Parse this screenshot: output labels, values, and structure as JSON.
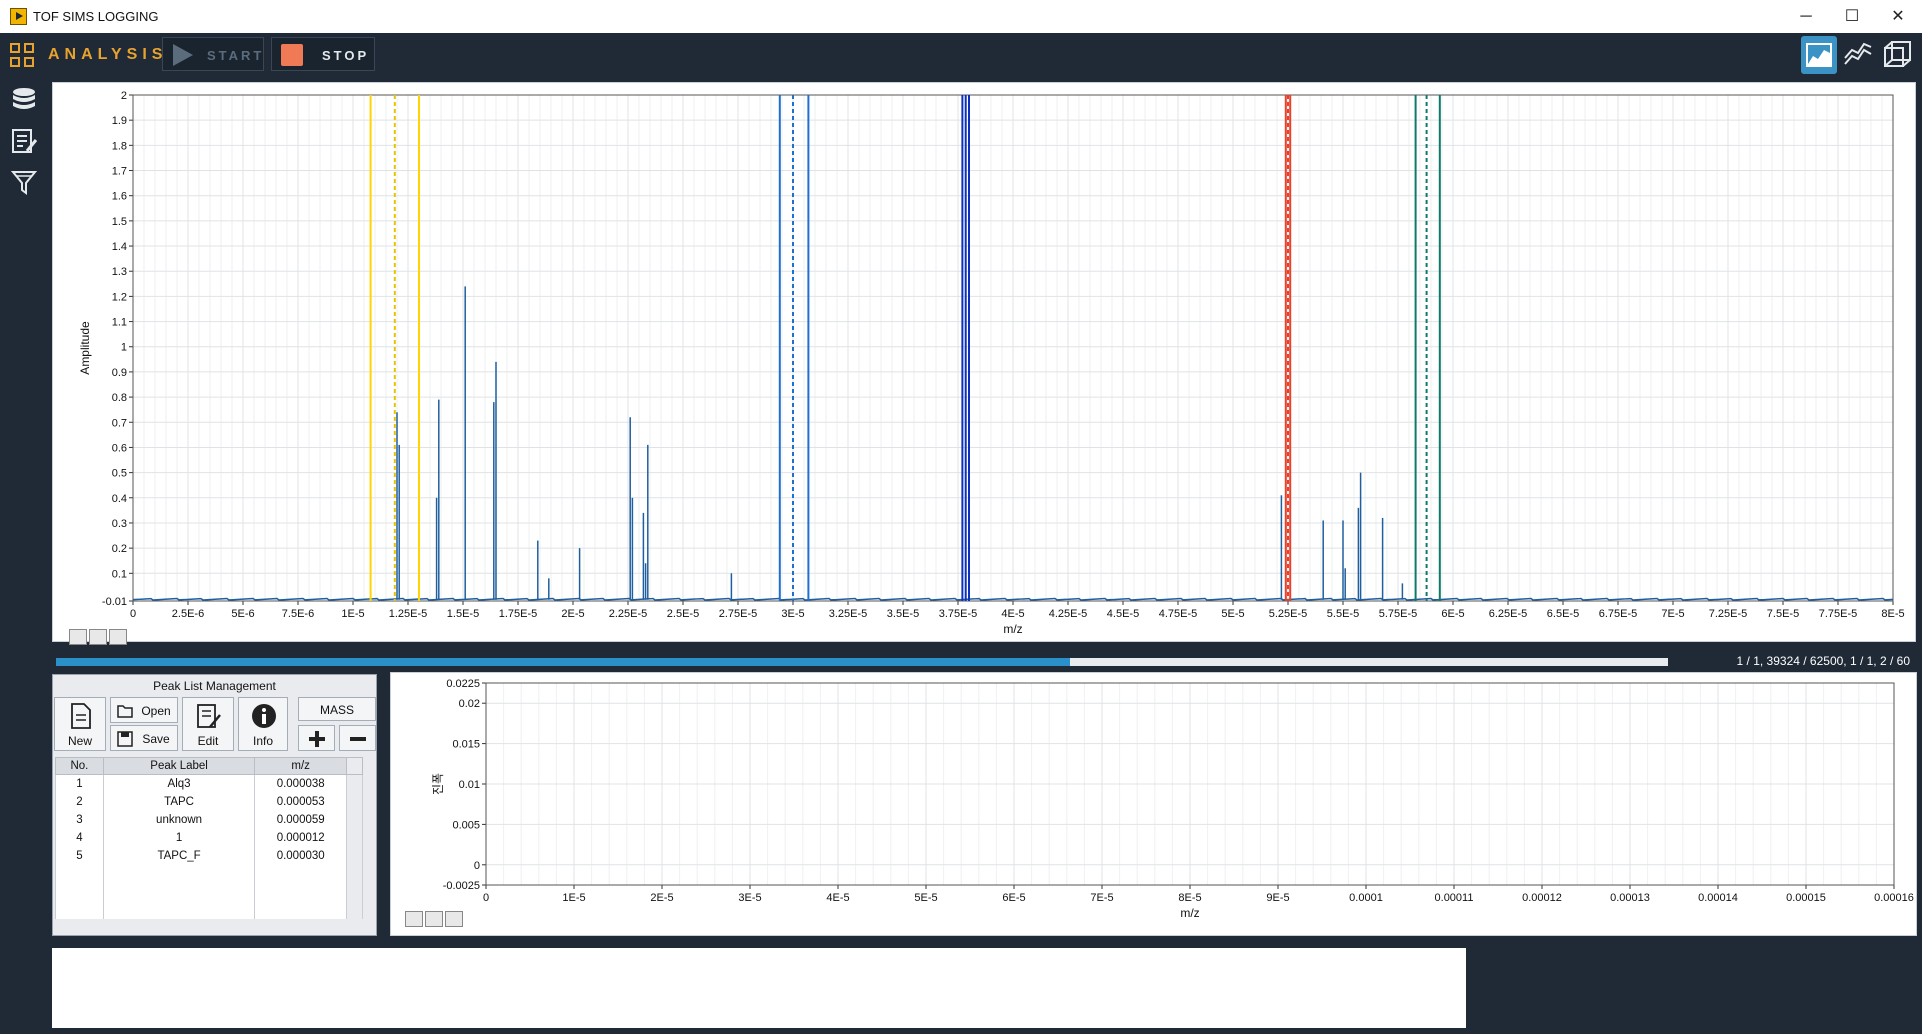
{
  "window": {
    "title": "TOF SIMS LOGGING",
    "controls": [
      "─",
      "☐",
      "✕"
    ]
  },
  "toolbar": {
    "analysis_label": "ANALYSIS",
    "start_label": "START",
    "stop_label": "STOP",
    "accent": "#e8a32e",
    "stop_color": "#f07a55"
  },
  "sidebar": {
    "items": [
      {
        "icon": "database-icon"
      },
      {
        "icon": "edit-list-icon"
      },
      {
        "icon": "filter-icon"
      }
    ]
  },
  "view_buttons": [
    {
      "icon": "area-chart-icon",
      "active": true
    },
    {
      "icon": "line-chart-icon",
      "active": false
    },
    {
      "icon": "3d-cube-icon",
      "active": false
    }
  ],
  "progress": {
    "fraction": 0.6292,
    "text": "1 / 1, 39324 / 62500, 1 / 1, 2 / 60"
  },
  "peak_panel": {
    "title": "Peak List Management",
    "new_label": "New",
    "open_label": "Open",
    "save_label": "Save",
    "edit_label": "Edit",
    "info_label": "Info",
    "mass_label": "MASS",
    "columns": [
      "No.",
      "Peak Label",
      "m/z"
    ],
    "rows": [
      [
        "1",
        "Alq3",
        "0.000038"
      ],
      [
        "2",
        "TAPC",
        "0.000053"
      ],
      [
        "3",
        "unknown",
        "0.000059"
      ],
      [
        "4",
        "1",
        "0.000012"
      ],
      [
        "5",
        "TAPC_F",
        "0.000030"
      ]
    ]
  },
  "chart_data": [
    {
      "type": "line",
      "xlabel": "m/z",
      "ylabel": "Amplitude",
      "xlim": [
        0,
        8e-05
      ],
      "ylim": [
        -0.01,
        2
      ],
      "xticks": [
        "0",
        "2.5E-6",
        "5E-6",
        "7.5E-6",
        "1E-5",
        "1.25E-5",
        "1.5E-5",
        "1.75E-5",
        "2E-5",
        "2.25E-5",
        "2.5E-5",
        "2.75E-5",
        "3E-5",
        "3.25E-5",
        "3.5E-5",
        "3.75E-5",
        "4E-5",
        "4.25E-5",
        "4.5E-5",
        "4.75E-5",
        "5E-5",
        "5.25E-5",
        "5.5E-5",
        "5.75E-5",
        "6E-5",
        "6.25E-5",
        "6.5E-5",
        "6.75E-5",
        "7E-5",
        "7.25E-5",
        "7.5E-5",
        "7.75E-5",
        "8E-5"
      ],
      "yticks": [
        "-0.01",
        "0.1",
        "0.2",
        "0.3",
        "0.4",
        "0.5",
        "0.6",
        "0.7",
        "0.8",
        "0.9",
        "1",
        "1.1",
        "1.2",
        "1.3",
        "1.4",
        "1.5",
        "1.6",
        "1.7",
        "1.8",
        "1.9",
        "2"
      ],
      "grid": true,
      "series_color": "#1f5f9e",
      "peaks": [
        {
          "x": 1.21e-05,
          "y": 0.61
        },
        {
          "x": 1.2e-05,
          "y": 0.74
        },
        {
          "x": 1.39e-05,
          "y": 0.79
        },
        {
          "x": 1.38e-05,
          "y": 0.4
        },
        {
          "x": 1.51e-05,
          "y": 1.24
        },
        {
          "x": 1.64e-05,
          "y": 0.78
        },
        {
          "x": 1.65e-05,
          "y": 0.94
        },
        {
          "x": 1.84e-05,
          "y": 0.23
        },
        {
          "x": 1.89e-05,
          "y": 0.08
        },
        {
          "x": 2.03e-05,
          "y": 0.2
        },
        {
          "x": 2.26e-05,
          "y": 0.72
        },
        {
          "x": 2.27e-05,
          "y": 0.4
        },
        {
          "x": 2.32e-05,
          "y": 0.34
        },
        {
          "x": 2.34e-05,
          "y": 0.61
        },
        {
          "x": 2.33e-05,
          "y": 0.14
        },
        {
          "x": 2.72e-05,
          "y": 0.1
        },
        {
          "x": 5.22e-05,
          "y": 0.41
        },
        {
          "x": 5.24e-05,
          "y": 0.39
        },
        {
          "x": 5.41e-05,
          "y": 0.31
        },
        {
          "x": 5.5e-05,
          "y": 0.31
        },
        {
          "x": 5.51e-05,
          "y": 0.12
        },
        {
          "x": 5.58e-05,
          "y": 0.5
        },
        {
          "x": 5.57e-05,
          "y": 0.36
        },
        {
          "x": 5.68e-05,
          "y": 0.32
        },
        {
          "x": 5.77e-05,
          "y": 0.06
        }
      ],
      "markers": [
        {
          "x": 1.08e-05,
          "color": "#ffd400",
          "style": "solid"
        },
        {
          "x": 1.19e-05,
          "color": "#e8c400",
          "style": "dashed"
        },
        {
          "x": 1.3e-05,
          "color": "#ffd400",
          "style": "solid"
        },
        {
          "x": 2.94e-05,
          "color": "#1e6fd0",
          "style": "solid"
        },
        {
          "x": 3e-05,
          "color": "#1e6fd0",
          "style": "dashed"
        },
        {
          "x": 3.07e-05,
          "color": "#1e6fd0",
          "style": "solid"
        },
        {
          "x": 3.77e-05,
          "color": "#0b2fbf",
          "style": "solid"
        },
        {
          "x": 3.785e-05,
          "color": "#0b2fbf",
          "style": "solid"
        },
        {
          "x": 3.8e-05,
          "color": "#0b2fbf",
          "style": "solid"
        },
        {
          "x": 5.24e-05,
          "color": "#e8402a",
          "style": "solid"
        },
        {
          "x": 5.25e-05,
          "color": "#e8402a",
          "style": "dashed"
        },
        {
          "x": 5.26e-05,
          "color": "#e8402a",
          "style": "solid"
        },
        {
          "x": 5.83e-05,
          "color": "#0f7a6a",
          "style": "solid"
        },
        {
          "x": 5.88e-05,
          "color": "#0f7a6a",
          "style": "dashed"
        },
        {
          "x": 5.94e-05,
          "color": "#0f7a6a",
          "style": "solid"
        }
      ]
    },
    {
      "type": "line",
      "xlabel": "m/z",
      "ylabel": "진폭",
      "xlim": [
        0,
        0.00016
      ],
      "ylim": [
        -0.0025,
        0.0225
      ],
      "xticks": [
        "0",
        "1E-5",
        "2E-5",
        "3E-5",
        "4E-5",
        "5E-5",
        "6E-5",
        "7E-5",
        "8E-5",
        "9E-5",
        "0.0001",
        "0.00011",
        "0.00012",
        "0.00013",
        "0.00014",
        "0.00015",
        "0.00016"
      ],
      "yticks": [
        "-0.0025",
        "0",
        "0.005",
        "0.01",
        "0.015",
        "0.02",
        "0.0225"
      ],
      "grid": true,
      "series": []
    }
  ]
}
